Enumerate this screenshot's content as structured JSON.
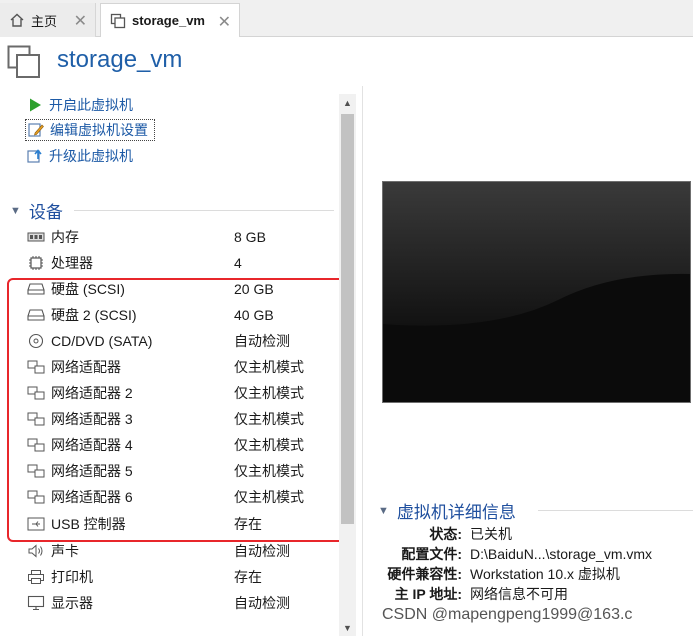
{
  "tabs": [
    {
      "label": "主页",
      "icon": "home-icon"
    },
    {
      "label": "storage_vm",
      "icon": "vm-icon"
    }
  ],
  "vm_title": "storage_vm",
  "actions": [
    {
      "label": "开启此虚拟机",
      "icon": "play-icon"
    },
    {
      "label": "编辑虚拟机设置",
      "icon": "edit-settings-icon"
    },
    {
      "label": "升级此虚拟机",
      "icon": "upgrade-icon"
    }
  ],
  "devices_section": "设备",
  "devices": [
    {
      "name": "内存",
      "value": "8 GB",
      "icon": "memory-icon"
    },
    {
      "name": "处理器",
      "value": "4",
      "icon": "processor-icon"
    },
    {
      "name": "硬盘 (SCSI)",
      "value": "20 GB",
      "icon": "hard-disk-icon"
    },
    {
      "name": "硬盘 2 (SCSI)",
      "value": "40 GB",
      "icon": "hard-disk-icon"
    },
    {
      "name": "CD/DVD (SATA)",
      "value": "自动检测",
      "icon": "cd-dvd-icon"
    },
    {
      "name": "网络适配器",
      "value": "仅主机模式",
      "icon": "network-adapter-icon"
    },
    {
      "name": "网络适配器 2",
      "value": "仅主机模式",
      "icon": "network-adapter-icon"
    },
    {
      "name": "网络适配器 3",
      "value": "仅主机模式",
      "icon": "network-adapter-icon"
    },
    {
      "name": "网络适配器 4",
      "value": "仅主机模式",
      "icon": "network-adapter-icon"
    },
    {
      "name": "网络适配器 5",
      "value": "仅主机模式",
      "icon": "network-adapter-icon"
    },
    {
      "name": "网络适配器 6",
      "value": "仅主机模式",
      "icon": "network-adapter-icon"
    },
    {
      "name": "USB 控制器",
      "value": "存在",
      "icon": "usb-icon"
    },
    {
      "name": "声卡",
      "value": "自动检测",
      "icon": "sound-card-icon"
    },
    {
      "name": "打印机",
      "value": "存在",
      "icon": "printer-icon"
    },
    {
      "name": "显示器",
      "value": "自动检测",
      "icon": "monitor-icon"
    }
  ],
  "details_section": "虚拟机详细信息",
  "details": [
    {
      "key": "状态:",
      "value": "已关机"
    },
    {
      "key": "配置文件:",
      "value": "D:\\BaiduN...\\storage_vm.vmx"
    },
    {
      "key": "硬件兼容性:",
      "value": "Workstation 10.x 虚拟机"
    },
    {
      "key": "主 IP 地址:",
      "value": "网络信息不可用"
    }
  ],
  "watermark": "CSDN @mapengpeng1999@163.c",
  "colors": {
    "accent": "#1f5fa8",
    "highlight_border": "#e8262b",
    "link": "#1d5aa6"
  }
}
